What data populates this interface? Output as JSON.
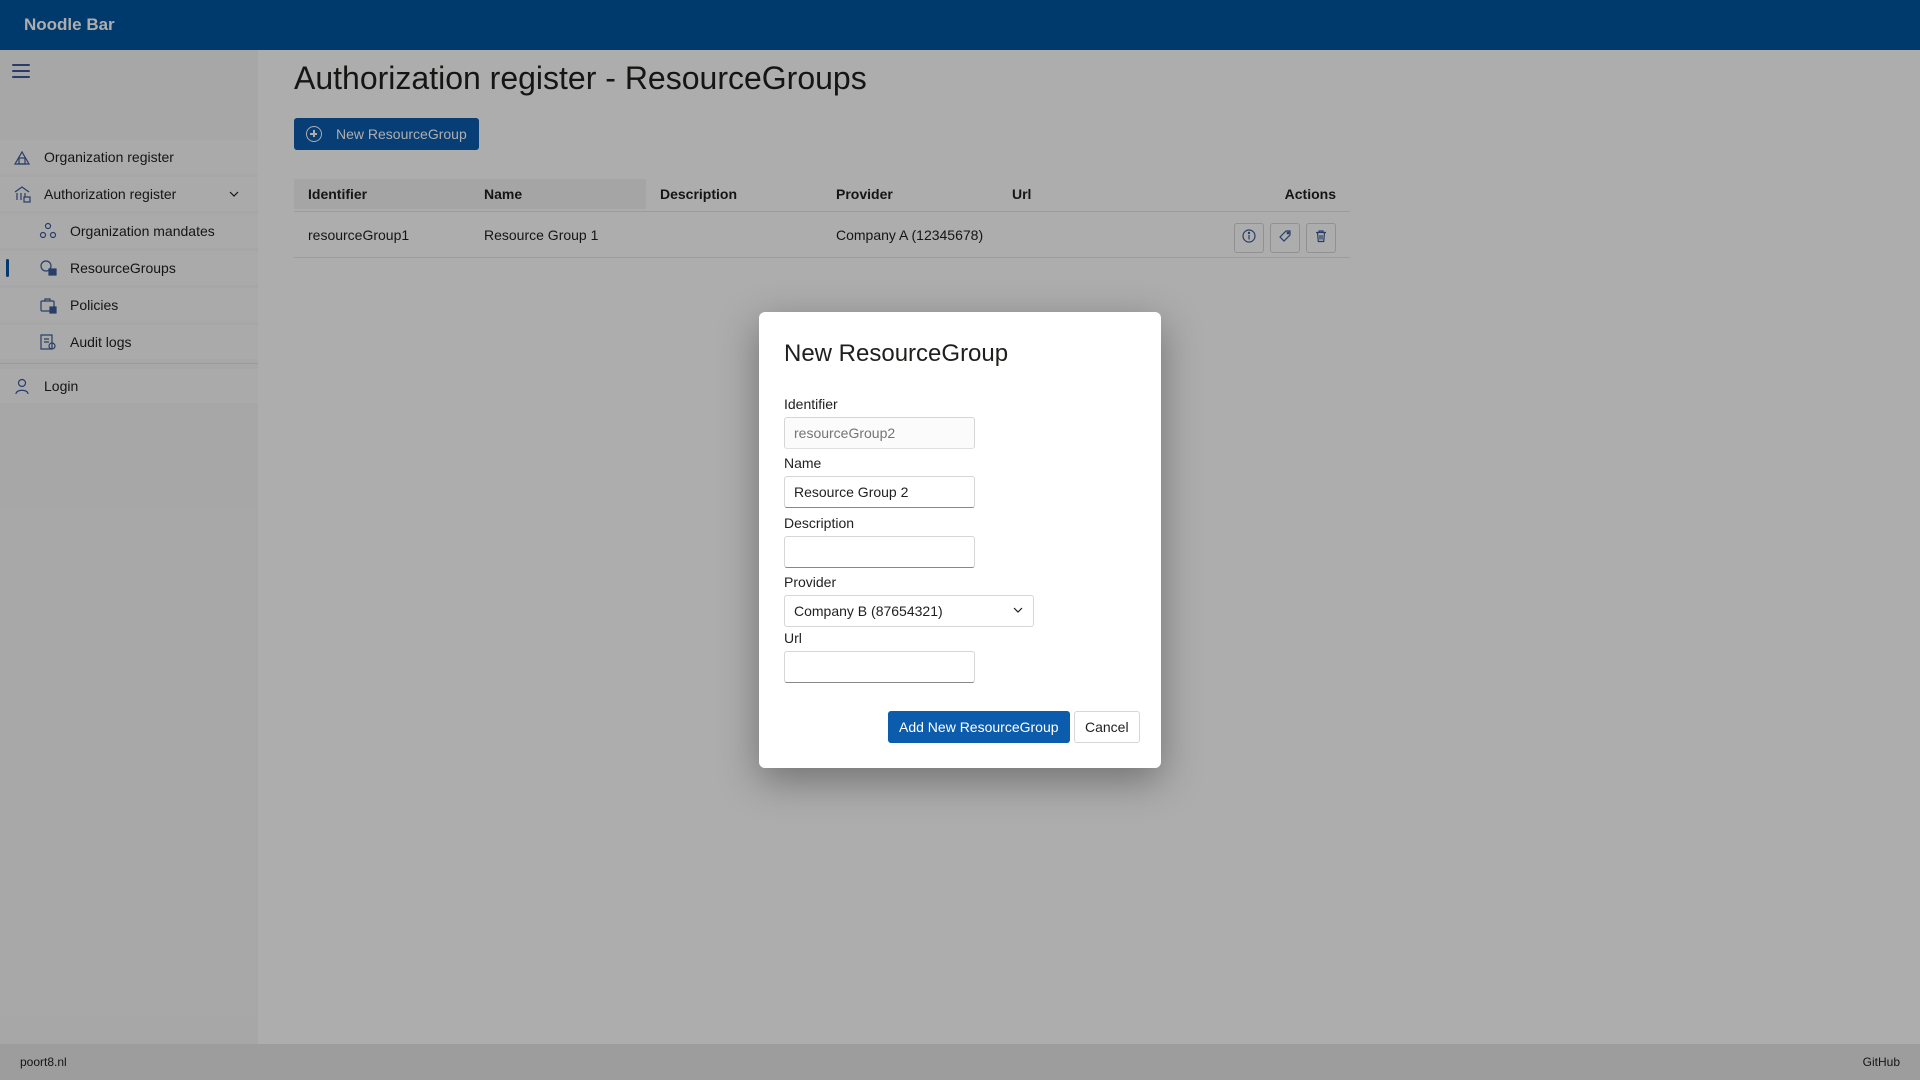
{
  "app": {
    "title": "Noodle Bar"
  },
  "sidebar": {
    "menu_icon": "hamburger-menu-icon",
    "items": [
      {
        "label": "Organization register",
        "icon": "organization-icon"
      },
      {
        "label": "Authorization register",
        "icon": "building-lock-icon",
        "expanded": true
      },
      {
        "label": "Organization mandates",
        "icon": "people-icon"
      },
      {
        "label": "ResourceGroups",
        "icon": "resource-group-icon",
        "active": true
      },
      {
        "label": "Policies",
        "icon": "briefcase-lock-icon"
      },
      {
        "label": "Audit logs",
        "icon": "document-search-icon"
      },
      {
        "label": "Login",
        "icon": "person-icon"
      }
    ]
  },
  "main": {
    "title": "Authorization register - ResourceGroups",
    "new_button_label": "New ResourceGroup",
    "table": {
      "columns": [
        "Identifier",
        "Name",
        "Description",
        "Provider",
        "Url",
        "Actions"
      ],
      "rows": [
        {
          "identifier": "resourceGroup1",
          "name": "Resource Group 1",
          "description": "",
          "provider": "Company A (12345678)",
          "url": ""
        }
      ],
      "row_actions": [
        "info-icon",
        "tag-icon",
        "trash-icon"
      ]
    }
  },
  "dialog": {
    "title": "New ResourceGroup",
    "fields": {
      "identifier_label": "Identifier",
      "identifier_placeholder": "resourceGroup2",
      "name_label": "Name",
      "name_value": "Resource Group 2",
      "description_label": "Description",
      "description_value": "",
      "provider_label": "Provider",
      "provider_value": "Company B (87654321)",
      "url_label": "Url",
      "url_value": ""
    },
    "add_button_label": "Add New ResourceGroup",
    "cancel_button_label": "Cancel"
  },
  "footer": {
    "left_text": "poort8.nl",
    "right_text": "GitHub"
  },
  "colors": {
    "brand": "#00569f",
    "primary_button": "#0b5cad",
    "overlay": "rgba(0,0,0,0.32)"
  }
}
